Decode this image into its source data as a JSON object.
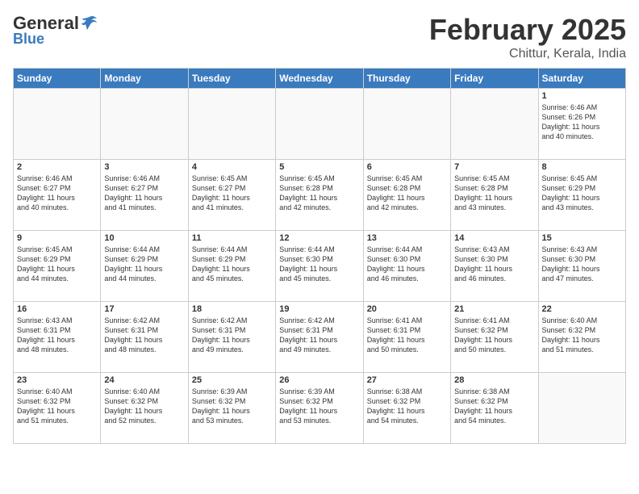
{
  "header": {
    "logo_general": "General",
    "logo_blue": "Blue",
    "month": "February 2025",
    "location": "Chittur, Kerala, India"
  },
  "weekdays": [
    "Sunday",
    "Monday",
    "Tuesday",
    "Wednesday",
    "Thursday",
    "Friday",
    "Saturday"
  ],
  "weeks": [
    [
      {
        "day": "",
        "info": ""
      },
      {
        "day": "",
        "info": ""
      },
      {
        "day": "",
        "info": ""
      },
      {
        "day": "",
        "info": ""
      },
      {
        "day": "",
        "info": ""
      },
      {
        "day": "",
        "info": ""
      },
      {
        "day": "1",
        "info": "Sunrise: 6:46 AM\nSunset: 6:26 PM\nDaylight: 11 hours\nand 40 minutes."
      }
    ],
    [
      {
        "day": "2",
        "info": "Sunrise: 6:46 AM\nSunset: 6:27 PM\nDaylight: 11 hours\nand 40 minutes."
      },
      {
        "day": "3",
        "info": "Sunrise: 6:46 AM\nSunset: 6:27 PM\nDaylight: 11 hours\nand 41 minutes."
      },
      {
        "day": "4",
        "info": "Sunrise: 6:45 AM\nSunset: 6:27 PM\nDaylight: 11 hours\nand 41 minutes."
      },
      {
        "day": "5",
        "info": "Sunrise: 6:45 AM\nSunset: 6:28 PM\nDaylight: 11 hours\nand 42 minutes."
      },
      {
        "day": "6",
        "info": "Sunrise: 6:45 AM\nSunset: 6:28 PM\nDaylight: 11 hours\nand 42 minutes."
      },
      {
        "day": "7",
        "info": "Sunrise: 6:45 AM\nSunset: 6:28 PM\nDaylight: 11 hours\nand 43 minutes."
      },
      {
        "day": "8",
        "info": "Sunrise: 6:45 AM\nSunset: 6:29 PM\nDaylight: 11 hours\nand 43 minutes."
      }
    ],
    [
      {
        "day": "9",
        "info": "Sunrise: 6:45 AM\nSunset: 6:29 PM\nDaylight: 11 hours\nand 44 minutes."
      },
      {
        "day": "10",
        "info": "Sunrise: 6:44 AM\nSunset: 6:29 PM\nDaylight: 11 hours\nand 44 minutes."
      },
      {
        "day": "11",
        "info": "Sunrise: 6:44 AM\nSunset: 6:29 PM\nDaylight: 11 hours\nand 45 minutes."
      },
      {
        "day": "12",
        "info": "Sunrise: 6:44 AM\nSunset: 6:30 PM\nDaylight: 11 hours\nand 45 minutes."
      },
      {
        "day": "13",
        "info": "Sunrise: 6:44 AM\nSunset: 6:30 PM\nDaylight: 11 hours\nand 46 minutes."
      },
      {
        "day": "14",
        "info": "Sunrise: 6:43 AM\nSunset: 6:30 PM\nDaylight: 11 hours\nand 46 minutes."
      },
      {
        "day": "15",
        "info": "Sunrise: 6:43 AM\nSunset: 6:30 PM\nDaylight: 11 hours\nand 47 minutes."
      }
    ],
    [
      {
        "day": "16",
        "info": "Sunrise: 6:43 AM\nSunset: 6:31 PM\nDaylight: 11 hours\nand 48 minutes."
      },
      {
        "day": "17",
        "info": "Sunrise: 6:42 AM\nSunset: 6:31 PM\nDaylight: 11 hours\nand 48 minutes."
      },
      {
        "day": "18",
        "info": "Sunrise: 6:42 AM\nSunset: 6:31 PM\nDaylight: 11 hours\nand 49 minutes."
      },
      {
        "day": "19",
        "info": "Sunrise: 6:42 AM\nSunset: 6:31 PM\nDaylight: 11 hours\nand 49 minutes."
      },
      {
        "day": "20",
        "info": "Sunrise: 6:41 AM\nSunset: 6:31 PM\nDaylight: 11 hours\nand 50 minutes."
      },
      {
        "day": "21",
        "info": "Sunrise: 6:41 AM\nSunset: 6:32 PM\nDaylight: 11 hours\nand 50 minutes."
      },
      {
        "day": "22",
        "info": "Sunrise: 6:40 AM\nSunset: 6:32 PM\nDaylight: 11 hours\nand 51 minutes."
      }
    ],
    [
      {
        "day": "23",
        "info": "Sunrise: 6:40 AM\nSunset: 6:32 PM\nDaylight: 11 hours\nand 51 minutes."
      },
      {
        "day": "24",
        "info": "Sunrise: 6:40 AM\nSunset: 6:32 PM\nDaylight: 11 hours\nand 52 minutes."
      },
      {
        "day": "25",
        "info": "Sunrise: 6:39 AM\nSunset: 6:32 PM\nDaylight: 11 hours\nand 53 minutes."
      },
      {
        "day": "26",
        "info": "Sunrise: 6:39 AM\nSunset: 6:32 PM\nDaylight: 11 hours\nand 53 minutes."
      },
      {
        "day": "27",
        "info": "Sunrise: 6:38 AM\nSunset: 6:32 PM\nDaylight: 11 hours\nand 54 minutes."
      },
      {
        "day": "28",
        "info": "Sunrise: 6:38 AM\nSunset: 6:32 PM\nDaylight: 11 hours\nand 54 minutes."
      },
      {
        "day": "",
        "info": ""
      }
    ]
  ]
}
